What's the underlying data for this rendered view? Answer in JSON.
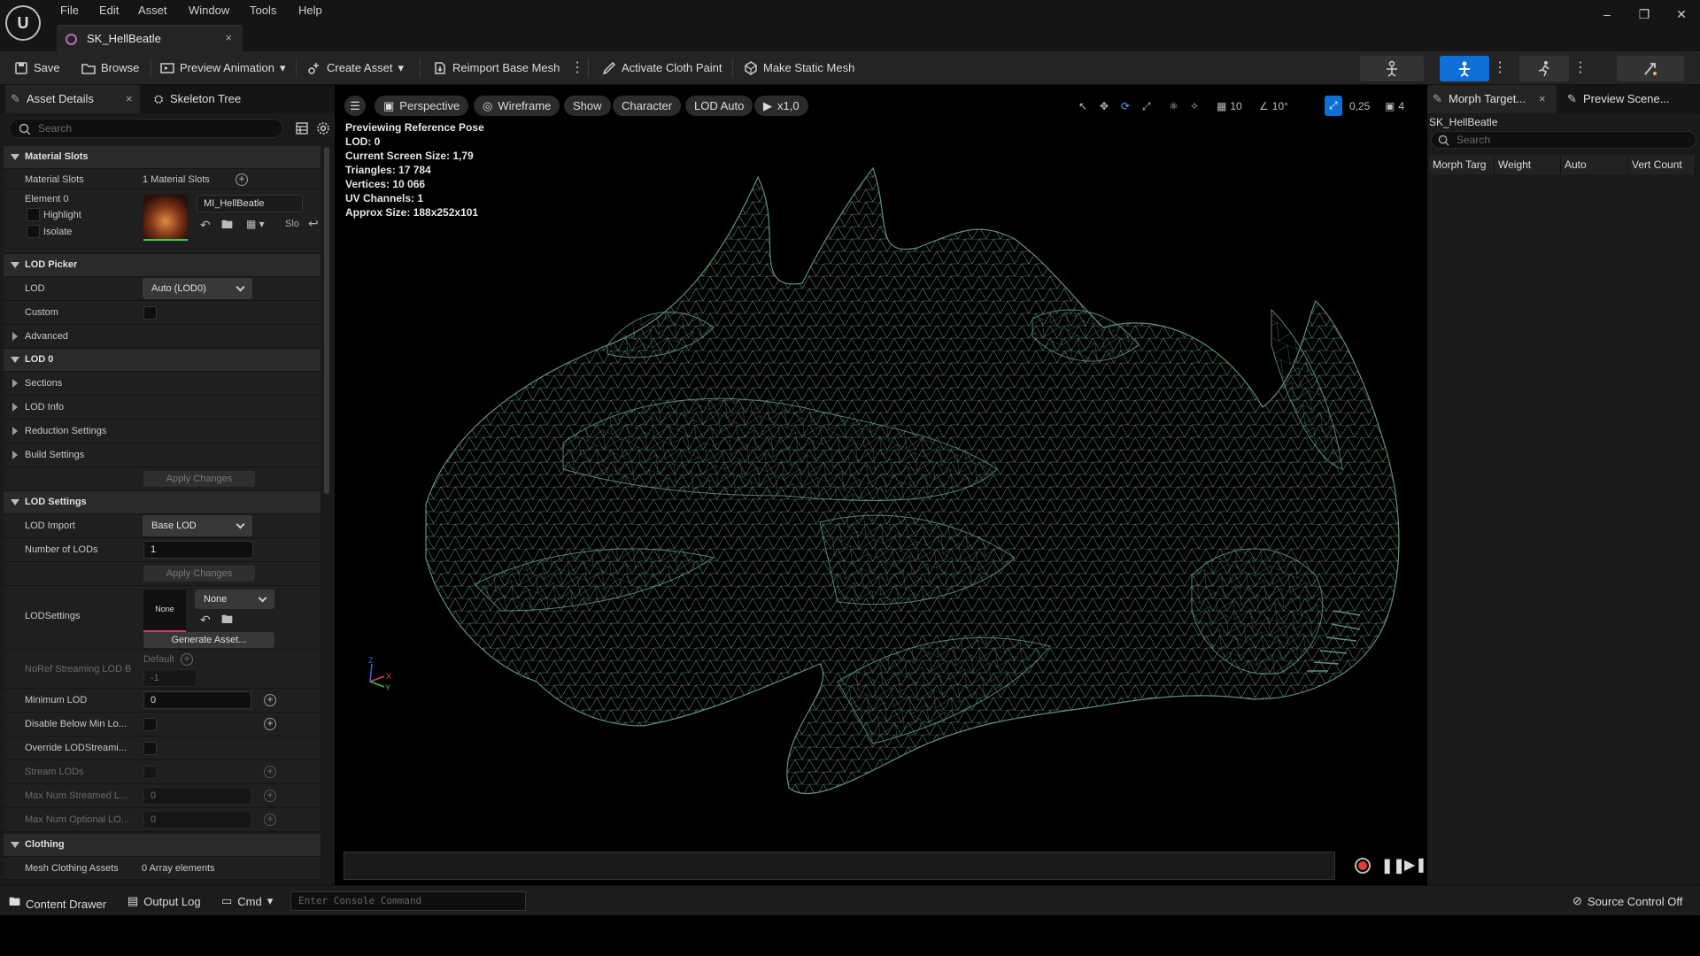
{
  "titlebar": {
    "menu": [
      "File",
      "Edit",
      "Asset",
      "Window",
      "Tools",
      "Help"
    ],
    "document_tab": "SK_HellBeatle",
    "close_glyph": "×"
  },
  "toolbar": {
    "save": "Save",
    "browse": "Browse",
    "preview_animation": "Preview Animation",
    "create_asset": "Create Asset",
    "reimport": "Reimport Base Mesh",
    "cloth_paint": "Activate Cloth Paint",
    "make_static": "Make Static Mesh"
  },
  "left_panel": {
    "tabs": [
      "Asset Details",
      "Skeleton Tree"
    ],
    "search_placeholder": "Search",
    "material_slots": {
      "header": "Material Slots",
      "label": "Material Slots",
      "count": "1 Material Slots",
      "element": "Element 0",
      "highlight": "Highlight",
      "isolate": "Isolate",
      "material": "MI_HellBeatle",
      "slot_short": "Slo"
    },
    "lod_picker": {
      "header": "LOD Picker",
      "lod_label": "LOD",
      "lod_value": "Auto (LOD0)",
      "custom_label": "Custom",
      "advanced": "Advanced"
    },
    "lod0": {
      "header": "LOD 0",
      "sections": "Sections",
      "lod_info": "LOD Info",
      "reduction": "Reduction Settings",
      "build": "Build Settings",
      "apply": "Apply Changes"
    },
    "lod_settings": {
      "header": "LOD Settings",
      "lod_import_label": "LOD Import",
      "lod_import_value": "Base LOD",
      "num_lods_label": "Number of LODs",
      "num_lods_value": "1",
      "apply": "Apply Changes",
      "lodsettings_label": "LODSettings",
      "lodsettings_thumb": "None",
      "lodsettings_value": "None",
      "generate": "Generate Asset...",
      "noref_label": "NoRef Streaming LOD B",
      "noref_default": "Default",
      "noref_value": "-1",
      "min_lod_label": "Minimum LOD",
      "min_lod_value": "0",
      "disable_below_label": "Disable Below Min Lo...",
      "override_label": "Override LODStreami...",
      "stream_lods_label": "Stream LODs",
      "max_streamed_label": "Max Num Streamed L...",
      "max_streamed_value": "0",
      "max_optional_label": "Max Num Optional LO...",
      "max_optional_value": "0"
    },
    "clothing": {
      "header": "Clothing",
      "assets_label": "Mesh Clothing Assets",
      "assets_value": "0 Array elements"
    }
  },
  "viewport": {
    "perspective": "Perspective",
    "wireframe": "Wireframe",
    "show": "Show",
    "character": "Character",
    "lod": "LOD Auto",
    "speed": "x1,0",
    "grid_snap": "10",
    "rot_snap": "10°",
    "scale_snap": "0,25",
    "cam_speed": "4",
    "stats": [
      "Previewing Reference Pose",
      "LOD: 0",
      "Current Screen Size: 1,79",
      "Triangles: 17 784",
      "Vertices: 10 066",
      "UV Channels: 1",
      "Approx Size: 188x252x101"
    ],
    "mesh_color": "#5f8f86"
  },
  "right_panel": {
    "tabs": [
      "Morph Target...",
      "Preview Scene..."
    ],
    "asset_name": "SK_HellBeatle",
    "search_placeholder": "Search",
    "columns": [
      "Morph Targ",
      "Weight",
      "Auto",
      "Vert Count"
    ]
  },
  "statusbar": {
    "content_drawer": "Content Drawer",
    "output_log": "Output Log",
    "cmd": "Cmd",
    "console_placeholder": "Enter Console Command",
    "source_control": "Source Control Off"
  },
  "colors": {
    "accent": "#0e6fd8",
    "record": "#e03a3a",
    "background": "#1a1a1a"
  }
}
